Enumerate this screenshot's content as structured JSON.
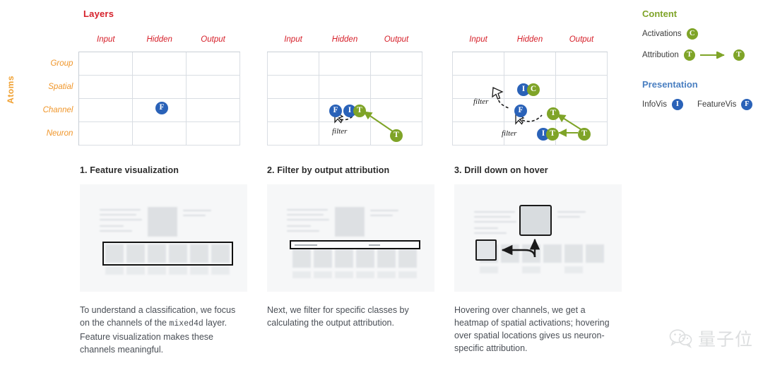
{
  "diagram": {
    "title": "Layers",
    "axis_label": "Atoms",
    "columns": [
      "Input",
      "Hidden",
      "Output"
    ],
    "rows": [
      "Group",
      "Spatial",
      "Channel",
      "Neuron"
    ],
    "filter_label": "filter",
    "grids": [
      {
        "name": "grid-1",
        "badges": [
          {
            "text": "F",
            "type": "presentation",
            "color": "#2a62b8",
            "col": "Hidden",
            "row": "Channel"
          }
        ]
      },
      {
        "name": "grid-2",
        "badges": [
          {
            "text": "F",
            "type": "presentation",
            "color": "#2a62b8",
            "col": "Hidden",
            "row": "Channel"
          },
          {
            "text": "I",
            "type": "presentation",
            "color": "#2a62b8",
            "col": "Hidden",
            "row": "Channel"
          },
          {
            "text": "T",
            "type": "content",
            "color": "#7fa428",
            "col": "Hidden",
            "row": "Channel"
          },
          {
            "text": "T",
            "type": "content",
            "color": "#7fa428",
            "col": "Output",
            "row": "Neuron"
          }
        ]
      },
      {
        "name": "grid-3",
        "badges": [
          {
            "text": "I",
            "type": "presentation",
            "color": "#2a62b8",
            "col": "Hidden",
            "row": "Spatial"
          },
          {
            "text": "C",
            "type": "content",
            "color": "#7fa428",
            "col": "Hidden",
            "row": "Spatial"
          },
          {
            "text": "F",
            "type": "presentation",
            "color": "#2a62b8",
            "col": "Hidden",
            "row": "Channel"
          },
          {
            "text": "T",
            "type": "content",
            "color": "#7fa428",
            "col": "Output",
            "row": "Channel"
          },
          {
            "text": "I",
            "type": "presentation",
            "color": "#2a62b8",
            "col": "Output",
            "row": "Neuron"
          },
          {
            "text": "T",
            "type": "content",
            "color": "#7fa428",
            "col": "Output",
            "row": "Neuron"
          },
          {
            "text": "T",
            "type": "content",
            "color": "#7fa428",
            "col": "Output",
            "row": "Neuron"
          }
        ]
      }
    ]
  },
  "legend": {
    "content_heading": "Content",
    "presentation_heading": "Presentation",
    "activations_label": "Activations",
    "activations_badge": "C",
    "attribution_label": "Attribution",
    "attribution_badge_from": "T",
    "attribution_badge_to": "T",
    "infovis_label": "InfoVis",
    "infovis_badge": "I",
    "featurevis_label": "FeatureVis",
    "featurevis_badge": "F",
    "colors": {
      "content": "#7fa428",
      "presentation": "#4a7fc1",
      "blue_badge": "#2a62b8",
      "green_badge": "#7fa428",
      "layers_title": "#d6202a",
      "atoms_label": "#f0a030",
      "row_label": "#f0962a"
    }
  },
  "panels": [
    {
      "heading": "1. Feature visualization",
      "caption_pre": "To understand a classification, we focus on the channels of the ",
      "caption_code": "mixed4d",
      "caption_post": " layer. Feature visualization makes these channels meaningful."
    },
    {
      "heading": "2. Filter by output attribution",
      "caption_pre": "Next, we filter for specific classes by calculating the output attribution.",
      "caption_code": "",
      "caption_post": ""
    },
    {
      "heading": "3. Drill down on hover",
      "caption_pre": "Hovering over channels, we get a heatmap of spatial activations; hovering over spatial locations gives us neuron-specific attribution.",
      "caption_code": "",
      "caption_post": ""
    }
  ],
  "watermark": {
    "text": "量子位"
  }
}
